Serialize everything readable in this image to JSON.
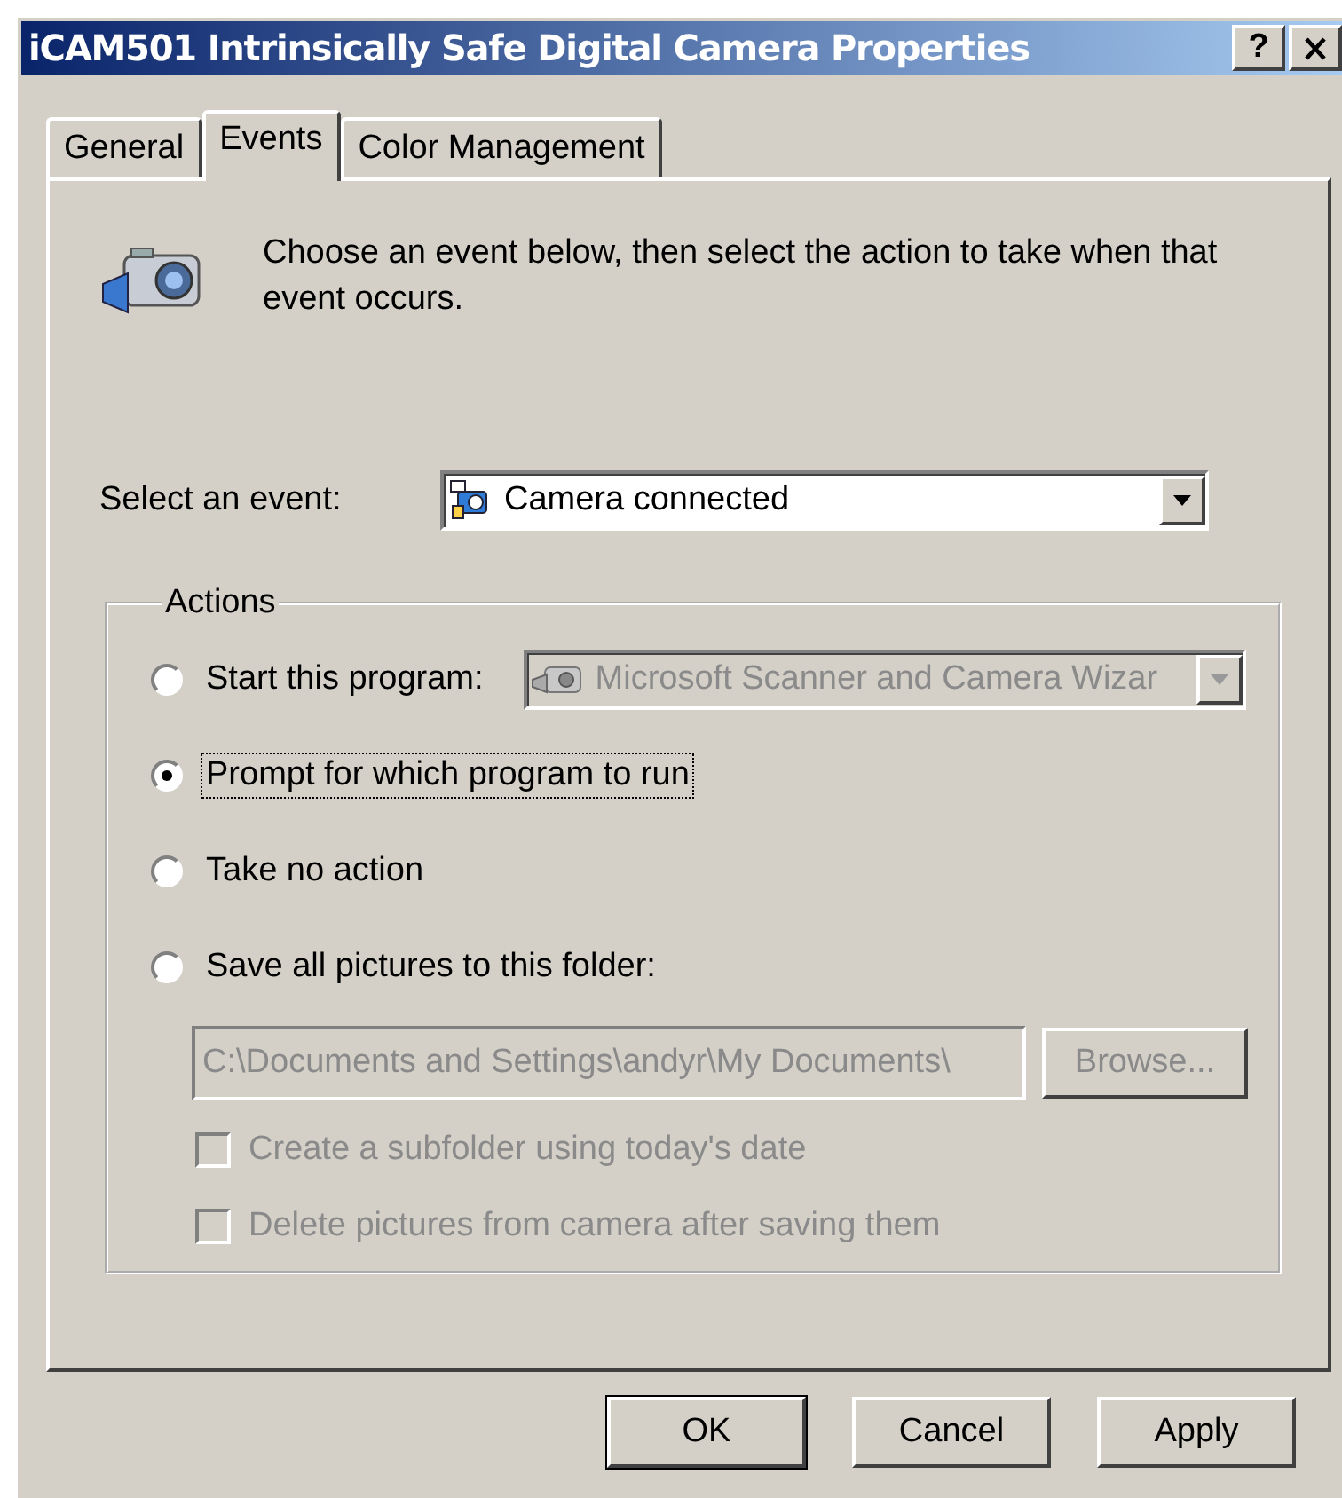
{
  "window": {
    "title": "iCAM501 Intrinsically Safe Digital Camera Properties",
    "help_button": "?"
  },
  "tabs": [
    {
      "label": "General",
      "selected": false
    },
    {
      "label": "Events",
      "selected": true
    },
    {
      "label": "Color Management",
      "selected": false
    }
  ],
  "description": "Choose an event below, then select the action to take when that event occurs.",
  "event": {
    "label": "Select an event:",
    "value": "Camera connected"
  },
  "actions": {
    "title": "Actions",
    "options": [
      {
        "kind": "program",
        "label": "Start this program:",
        "selected": false,
        "focused": false,
        "program": {
          "value": "Microsoft Scanner and Camera Wizar",
          "disabled": true
        }
      },
      {
        "kind": "plain",
        "label": "Prompt for which program to run",
        "selected": true,
        "focused": true
      },
      {
        "kind": "plain",
        "label": "Take no action",
        "selected": false,
        "focused": false
      },
      {
        "kind": "folder",
        "label": "Save all pictures to this folder:",
        "selected": false,
        "focused": false,
        "path": {
          "value": "C:\\Documents and Settings\\andyr\\My Documents\\",
          "disabled": true
        },
        "browse": {
          "label": "Browse...",
          "disabled": true
        }
      }
    ],
    "checkboxes": [
      {
        "label": "Create a subfolder using today's date",
        "checked": false,
        "disabled": true
      },
      {
        "label": "Delete pictures from camera after saving them",
        "checked": false,
        "disabled": true
      }
    ]
  },
  "buttons": [
    {
      "label": "OK",
      "kind": "default"
    },
    {
      "label": "Cancel",
      "kind": "normal"
    },
    {
      "label": "Apply",
      "kind": "normal"
    }
  ]
}
